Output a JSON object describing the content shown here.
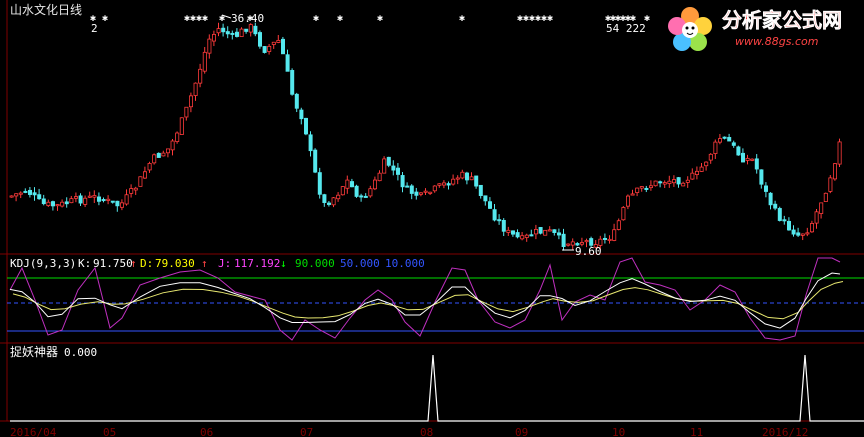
{
  "chart_data": [
    {
      "type": "candlestick",
      "title": "山水文化日线",
      "marks": [
        "2",
        "36.40",
        "54 222",
        "9.60"
      ],
      "colors": {
        "up": "#ff3b3b",
        "down": "#55e8ee",
        "text": "#ffffff",
        "title": "#e8e8e8"
      }
    },
    {
      "type": "line",
      "title": "KDJ(9,3,3)",
      "values": [
        {
          "label": "K:",
          "value": "91.750",
          "arrow": "↑",
          "color": "#ffffff"
        },
        {
          "label": "D:",
          "value": "79.030",
          "arrow": "↑",
          "color": "#ffff00"
        },
        {
          "label": "J:",
          "value": "117.192",
          "arrow": "↓",
          "color": "#ff44ff"
        }
      ],
      "levels": [
        {
          "value": "90.000",
          "color": "#00dd00"
        },
        {
          "value": "50.000",
          "color": "#3355ff"
        },
        {
          "value": "10.000",
          "color": "#3355ff"
        }
      ],
      "ylim": [
        0,
        100
      ]
    },
    {
      "type": "line",
      "title": "捉妖神器",
      "value": "0.000"
    }
  ],
  "x_ticks": [
    "2016/04",
    "05",
    "06",
    "07",
    "08",
    "09",
    "10",
    "11",
    "2016/12"
  ],
  "watermark": {
    "text": "分析家公式网",
    "url": "www.88gs.com"
  }
}
